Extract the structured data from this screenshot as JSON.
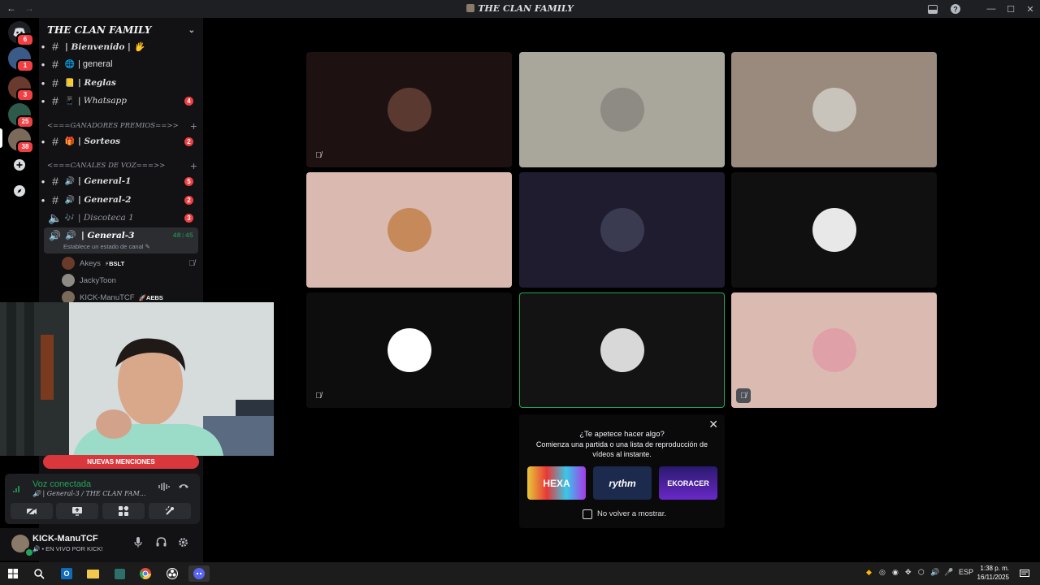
{
  "window": {
    "title": "THE CLAN FAMILY",
    "back_glyph": "←",
    "forward_glyph": "→"
  },
  "server_rail": {
    "discord_badge": "6",
    "servers": [
      {
        "badge": "1",
        "color": "#3a5a88"
      },
      {
        "badge": "3",
        "color": "#6a3a2e"
      },
      {
        "badge": "25",
        "color": "#2d5a4a"
      },
      {
        "badge": "38",
        "color": "#7a6a5a"
      }
    ]
  },
  "sidebar": {
    "guild_name": "THE CLAN FAMILY",
    "channels_top": [
      {
        "emoji": "🖐",
        "name": "| Bienvenido | 🖐",
        "badge": "",
        "style": "italic"
      },
      {
        "emoji": "🌐",
        "name": "| general",
        "badge": "",
        "style": "plain"
      },
      {
        "emoji": "📒",
        "name": "| Reglas",
        "badge": "",
        "style": "italic"
      },
      {
        "emoji": "📱",
        "name": "| Whatsapp",
        "badge": "4",
        "style": "italic-light"
      }
    ],
    "category_premios": "<===GANADORES PREMIOS==>>",
    "channel_sorteos": {
      "emoji": "🎁",
      "name": "| Sorteos",
      "badge": "2"
    },
    "category_voz": "<===CANALES DE VOZ===>>",
    "voice_channels": [
      {
        "name": "| General-1",
        "badge": "5"
      },
      {
        "name": "| General-2",
        "badge": "2"
      },
      {
        "name": "| Discoteca 1",
        "badge": "3"
      }
    ],
    "active_channel": {
      "name": "| General-3",
      "timer": "48:45",
      "status": "Establece un estado de canal"
    },
    "voice_users": [
      {
        "name": "Akeys",
        "tag": "⚡BSLT",
        "muted": true
      },
      {
        "name": "JackyToon",
        "tag": "",
        "muted": false
      },
      {
        "name": "KICK-ManuTCF",
        "tag": "🚀AEBS",
        "muted": false
      }
    ]
  },
  "mentions_pill": "NUEVAS MENCIONES",
  "voice_panel": {
    "title": "Voz conectada",
    "subtitle": "| General-3 / THE CLAN FAM..."
  },
  "user_panel": {
    "name": "KICK-ManuTCF",
    "status": "• EN VIVO POR KICK!"
  },
  "tiles": [
    {
      "bg": "#1e1112",
      "avatar_bg": "#5a3a30",
      "muted": true,
      "boxed": false,
      "speaking": false
    },
    {
      "bg": "#a9a69b",
      "avatar_bg": "#8e8a84",
      "muted": false,
      "boxed": false,
      "speaking": false
    },
    {
      "bg": "#998a7d",
      "avatar_bg": "#c8c3bb",
      "muted": false,
      "boxed": false,
      "speaking": false
    },
    {
      "bg": "#dab9b1",
      "avatar_bg": "#c68a5a",
      "muted": false,
      "boxed": false,
      "speaking": false
    },
    {
      "bg": "#1f1c2f",
      "avatar_bg": "#3a3a50",
      "muted": false,
      "boxed": false,
      "speaking": false
    },
    {
      "bg": "#101010",
      "avatar_bg": "#e8e8e8",
      "muted": false,
      "boxed": false,
      "speaking": false
    },
    {
      "bg": "#0d0d0d",
      "avatar_bg": "#ffffff",
      "muted": true,
      "boxed": false,
      "speaking": false
    },
    {
      "bg": "#131313",
      "avatar_bg": "#d8d8d8",
      "muted": false,
      "boxed": false,
      "speaking": true
    },
    {
      "bg": "#dbbbb1",
      "avatar_bg": "#e0a0a8",
      "muted": true,
      "boxed": true,
      "speaking": false
    }
  ],
  "promo": {
    "heading": "¿Te apetece hacer algo?",
    "body": "Comienza una partida o una lista de reproducción de vídeos al instante.",
    "games": [
      "HEXA",
      "rythm",
      "EKORACER"
    ],
    "checkbox_label": "No volver a mostrar."
  },
  "taskbar": {
    "lang": "ESP",
    "time": "1:38 p. m.",
    "date": "16/11/2025"
  }
}
